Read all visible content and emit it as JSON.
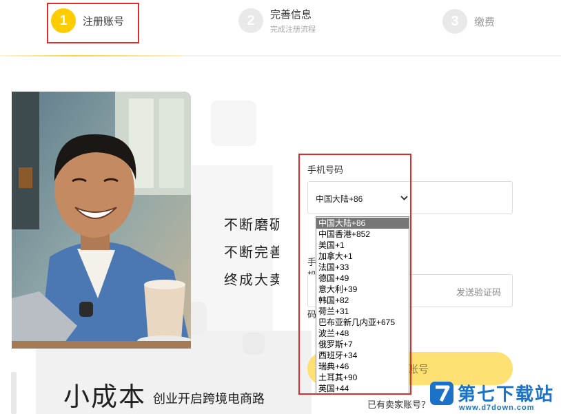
{
  "steps": [
    {
      "number": "1",
      "title": "注册账号",
      "subtitle": ""
    },
    {
      "number": "2",
      "title": "完善信息",
      "subtitle": "完成注册流程"
    },
    {
      "number": "3",
      "title": "缴费",
      "subtitle": ""
    }
  ],
  "slogan": {
    "line1": "不断磨砺",
    "line2": "不断完善",
    "line3": "终成大卖",
    "big_title": "小成本",
    "big_subtitle": "创业开启跨境电商路"
  },
  "form": {
    "phone_label": "手机号码",
    "code_label": "手机验证码",
    "country_selected": "中国大陆+86",
    "send_code": "发送验证码",
    "register_button": "注册账号",
    "login_hint": "已有卖家账号？"
  },
  "dropdown": {
    "options": [
      "中国大陆+86",
      "中国香港+852",
      "美国+1",
      "加拿大+1",
      "法国+33",
      "德国+49",
      "意大利+39",
      "韩国+82",
      "荷兰+31",
      "巴布亚新几内亚+675",
      "波兰+48",
      "俄罗斯+7",
      "西班牙+34",
      "瑞典+46",
      "土耳其+90",
      "英国+44"
    ],
    "selected_index": 0
  },
  "watermark": {
    "name": "第七下载站",
    "url": "www.d7down.com"
  },
  "colors": {
    "accent": "#ffcc00",
    "highlight_box": "#e02b2b",
    "watermark": "#1a72c9"
  }
}
